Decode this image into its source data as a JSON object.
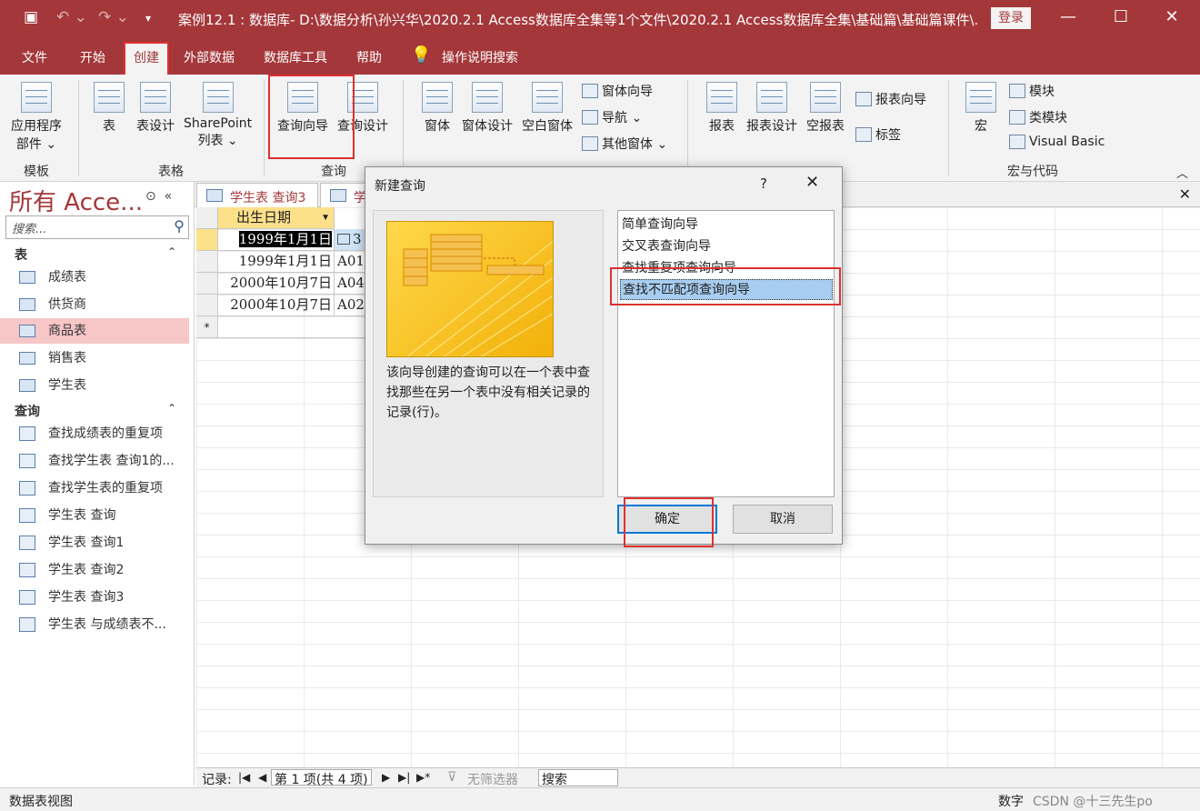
{
  "titlebar": {
    "title": "案例12.1 : 数据库- D:\\数据分析\\孙兴华\\2020.2.1 Access数据库全集等1个文件\\2020.2.1 Access数据库全集\\基础篇\\基础篇课件\\...",
    "login": "登录"
  },
  "menu": {
    "tabs": [
      "文件",
      "开始",
      "创建",
      "外部数据",
      "数据库工具",
      "帮助"
    ],
    "active": "创建",
    "search": "操作说明搜索"
  },
  "ribbon": {
    "templates": {
      "app_parts": "应用程序",
      "app_parts_2": "部件 ⌄",
      "group": "模板"
    },
    "tables": {
      "table": "表",
      "table_design": "表设计",
      "sharepoint": "SharePoint",
      "sharepoint_2": "列表 ⌄",
      "group": "表格"
    },
    "queries": {
      "wizard": "查询向导",
      "design": "查询设计",
      "group": "查询"
    },
    "forms": {
      "form": "窗体",
      "form_design": "窗体设计",
      "blank_form": "空白窗体",
      "form_wizard": "窗体向导",
      "navigation": "导航 ⌄",
      "more_forms": "其他窗体 ⌄"
    },
    "reports": {
      "report": "报表",
      "report_design": "报表设计",
      "blank_report": "空报表",
      "report_wizard": "报表向导",
      "labels": "标签"
    },
    "macros": {
      "macro": "宏",
      "module": "模块",
      "class_module": "类模块",
      "visual_basic": "Visual Basic",
      "group": "宏与代码"
    }
  },
  "nav": {
    "header": "所有 Acce...",
    "search_placeholder": "搜索...",
    "tables_section": "表",
    "tables": [
      "成绩表",
      "供货商",
      "商品表",
      "销售表",
      "学生表"
    ],
    "selected_table": "商品表",
    "queries_section": "查询",
    "queries": [
      "查找成绩表的重复项",
      "查找学生表 查询1的...",
      "查找学生表的重复项",
      "学生表 查询",
      "学生表 查询1",
      "学生表 查询2",
      "学生表 查询3",
      "学生表 与成绩表不..."
    ]
  },
  "doctabs": {
    "tab1": "学生表 查询3",
    "tab2": "学"
  },
  "sheet": {
    "column_header": "出生日期",
    "rows": [
      {
        "date": "1999年1月1日",
        "code": "3"
      },
      {
        "date": "1999年1月1日",
        "code": "A01"
      },
      {
        "date": "2000年10月7日",
        "code": "A04"
      },
      {
        "date": "2000年10月7日",
        "code": "A02"
      }
    ],
    "new_row_marker": "*"
  },
  "recnav": {
    "label": "记录:",
    "position": "第 1 项(共 4 项)",
    "filter": "无筛选器",
    "search": "搜索"
  },
  "status": {
    "view": "数据表视图",
    "mode": "数字",
    "watermark": "CSDN @十三先生po"
  },
  "dialog": {
    "title": "新建查询",
    "help": "?",
    "description": "该向导创建的查询可以在一个表中查找那些在另一个表中没有相关记录的记录(行)。",
    "options": [
      "简单查询向导",
      "交叉表查询向导",
      "查找重复项查询向导",
      "查找不匹配项查询向导"
    ],
    "selected": "查找不匹配项查询向导",
    "ok": "确定",
    "cancel": "取消"
  },
  "colors": {
    "accent": "#a4373a",
    "highlight_box": "#e03030",
    "selection": "#a7cdf0"
  }
}
